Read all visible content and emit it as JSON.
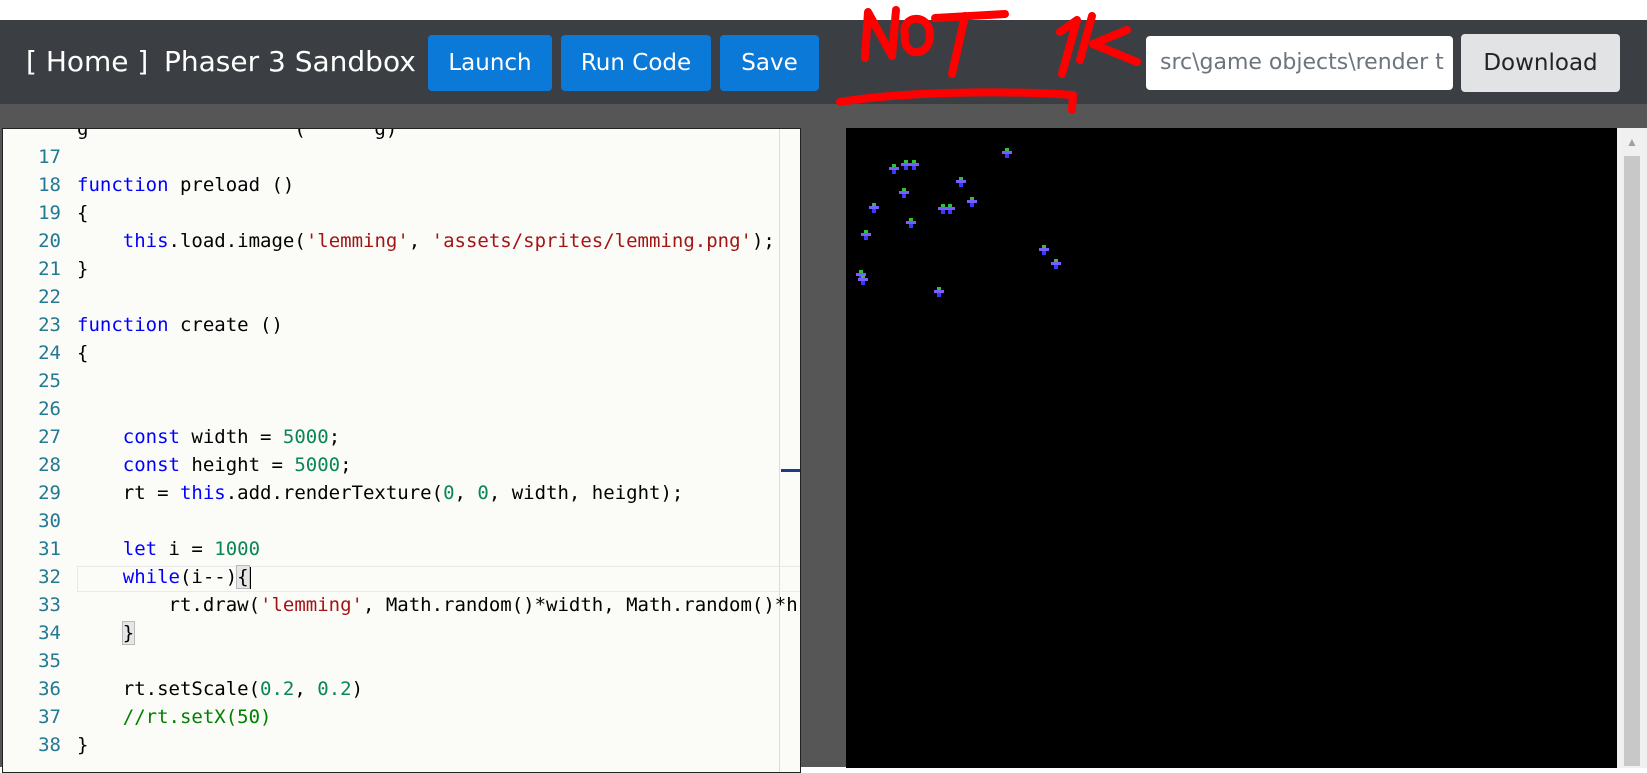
{
  "navbar": {
    "home_link": "[ Home ]",
    "title": "Phaser 3 Sandbox",
    "launch_label": "Launch",
    "run_code_label": "Run Code",
    "save_label": "Save",
    "path_value": "src\\game objects\\render t",
    "download_label": "Download"
  },
  "annotation": {
    "text": "NOT 1k",
    "color": "#ff0000"
  },
  "editor": {
    "partial_top_line": "g                  (      g)"
  },
  "canvas": {
    "sprite_name": "lemming"
  },
  "colors": {
    "accent": "#0b79d8",
    "navbar": "#3b3f44",
    "canvas": "#000000"
  }
}
